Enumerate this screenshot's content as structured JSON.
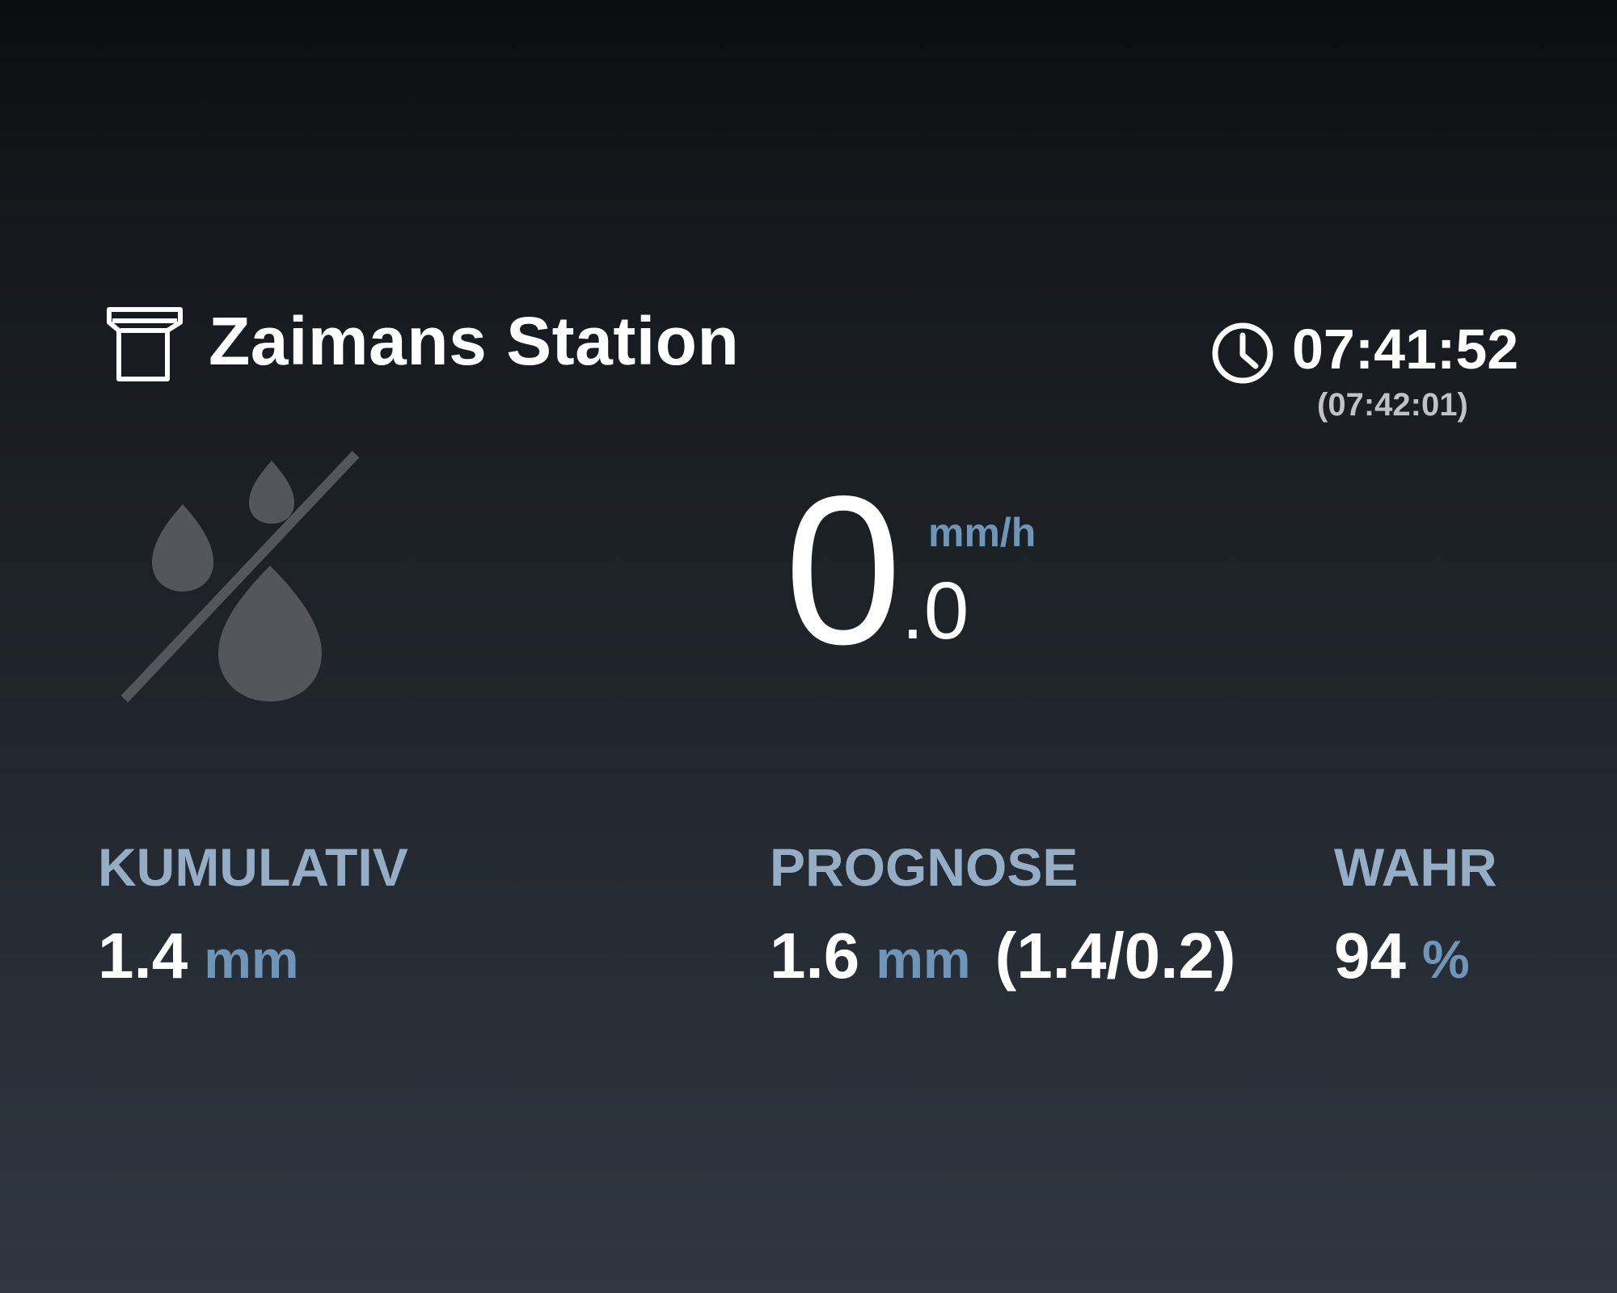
{
  "header": {
    "station_icon": "rain-gauge-icon",
    "station_name": "Zaimans Station",
    "clock_icon": "clock-icon",
    "time": "07:41:52",
    "time_secondary": "(07:42:01)"
  },
  "current": {
    "weather_icon": "no-rain-icon",
    "rate_integer": "0",
    "rate_decimal": ".0",
    "rate_unit": "mm/h"
  },
  "stats": {
    "cumulative": {
      "label": "KUMULATIV",
      "value": "1.4",
      "unit": "mm"
    },
    "forecast": {
      "label": "PROGNOSE",
      "value": "1.6",
      "unit": "mm",
      "detail": "(1.4/0.2)"
    },
    "probability": {
      "label": "WAHR",
      "value": "94",
      "unit": "%"
    }
  },
  "colors": {
    "text_primary": "#ffffff",
    "label": "#95aec6",
    "unit_accent": "#6f95b8",
    "secondary_time": "#bfc3c7",
    "icon_gray": "#53575b"
  }
}
